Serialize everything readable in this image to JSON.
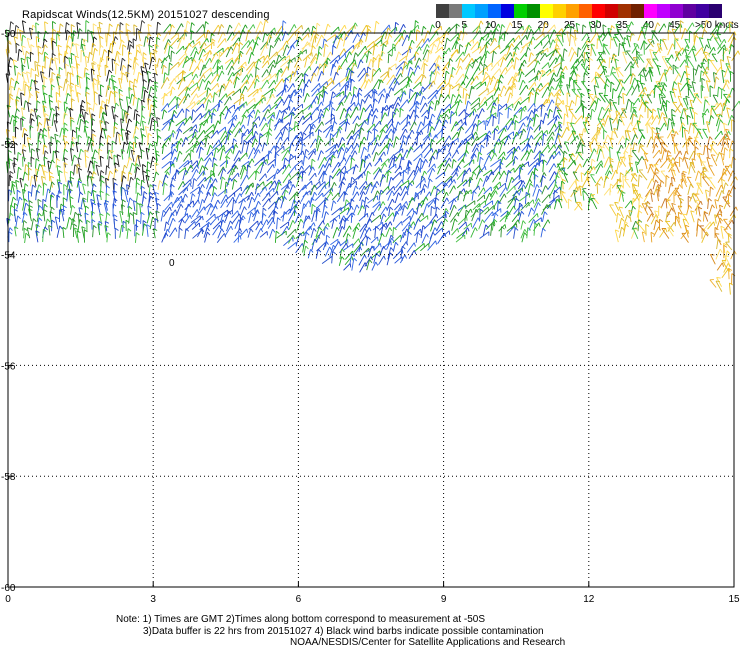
{
  "title": "Rapidscat Winds(12.5KM) 20151027 descending",
  "legend": {
    "units": "knots",
    "colors": [
      "#404040",
      "#7a7a7a",
      "#00c8ff",
      "#00a0ff",
      "#0064ff",
      "#0000e0",
      "#00d000",
      "#009000",
      "#ffff00",
      "#ffd000",
      "#ffa000",
      "#ff6000",
      "#ff0000",
      "#d00000",
      "#a03000",
      "#702000",
      "#ff00ff",
      "#c000ff",
      "#9000d0",
      "#6000a0",
      "#4000a0",
      "#2a0070"
    ],
    "ticks": [
      "0",
      "5",
      "10",
      "15",
      "20",
      "25",
      "30",
      "35",
      "40",
      "45",
      ">50 knots"
    ]
  },
  "axes": {
    "x_ticks": [
      "0",
      "3",
      "6",
      "9",
      "12",
      "15"
    ],
    "y_ticks": [
      "-50",
      "-52",
      "-54",
      "-56",
      "-58",
      "-60"
    ],
    "x_range": [
      0,
      15
    ],
    "y_range": [
      -50,
      -60
    ]
  },
  "notes": {
    "line1": "Note: 1) Times are GMT 2)Times along bottom correspond to measurement at -50S",
    "line2": "3)Data buffer is 22 hrs from 20151027 4) Black wind barbs indicate possible contamination",
    "line3": "NOAA/NESDIS/Center for Satellite Applications and Research"
  },
  "lone_marker": "0"
}
